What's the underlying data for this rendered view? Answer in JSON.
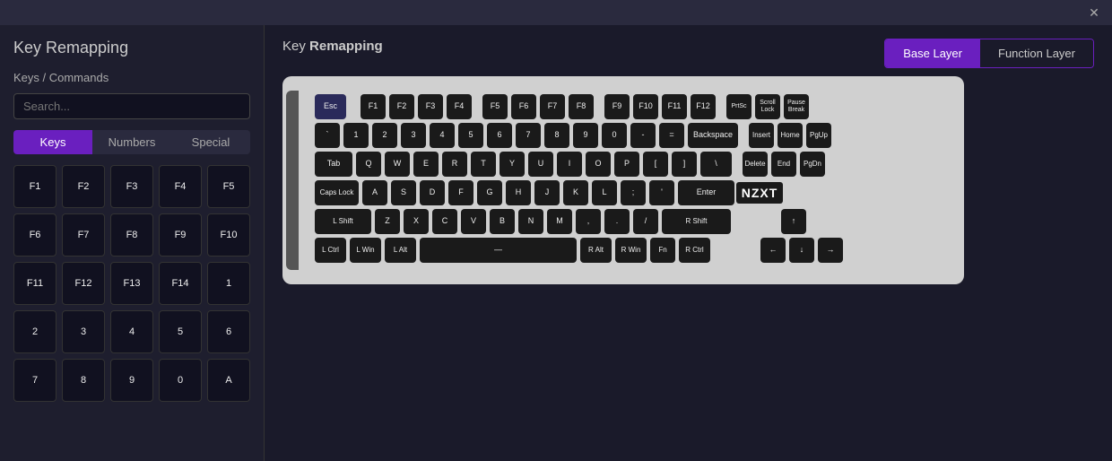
{
  "titlebar": {
    "close_label": "✕"
  },
  "page": {
    "title": "Key Remapping"
  },
  "sidebar": {
    "section_title": "Keys / Commands",
    "search_placeholder": "Search...",
    "tabs": [
      {
        "label": "Keys",
        "active": true
      },
      {
        "label": "Numbers",
        "active": false
      },
      {
        "label": "Special",
        "active": false
      }
    ],
    "keys": [
      "F1",
      "F2",
      "F3",
      "F4",
      "F5",
      "F6",
      "F7",
      "F8",
      "F9",
      "F10",
      "F11",
      "F12",
      "F13",
      "F14",
      "1",
      "2",
      "3",
      "4",
      "5",
      "6",
      "7",
      "8",
      "9",
      "0",
      "A"
    ]
  },
  "panel": {
    "title_plain": "Key ",
    "title_bold": "Remapping"
  },
  "layers": {
    "base_label": "Base Layer",
    "function_label": "Function Layer"
  },
  "keyboard": {
    "row0": [
      "Esc",
      "F1",
      "F2",
      "F3",
      "F4",
      "F5",
      "F6",
      "F7",
      "F8",
      "F9",
      "F10",
      "F11",
      "F12",
      "PrtSc",
      "Scroll Lock",
      "Pause Break"
    ],
    "row1": [
      "`",
      "1",
      "2",
      "3",
      "4",
      "5",
      "6",
      "7",
      "8",
      "9",
      "0",
      "-",
      "=",
      "Backspace",
      "Insert",
      "Home",
      "PgUp"
    ],
    "row2": [
      "Tab",
      "Q",
      "W",
      "E",
      "R",
      "T",
      "Y",
      "U",
      "I",
      "O",
      "P",
      "[",
      "]",
      "\\",
      "Delete",
      "End",
      "PgDn"
    ],
    "row3": [
      "Caps Lock",
      "A",
      "S",
      "D",
      "F",
      "G",
      "H",
      "J",
      "K",
      "L",
      ";",
      "'",
      "Enter"
    ],
    "row4": [
      "L Shift",
      "Z",
      "X",
      "C",
      "V",
      "B",
      "N",
      "M",
      ",",
      ".",
      "/ ",
      "R Shift",
      "↑"
    ],
    "row5": [
      "L Ctrl",
      "L Win",
      "L Alt",
      "—",
      "R Alt",
      "R Win",
      "Fn",
      "R Ctrl",
      "←",
      "↓",
      "→"
    ]
  },
  "nzxt_brand": "NZXT"
}
